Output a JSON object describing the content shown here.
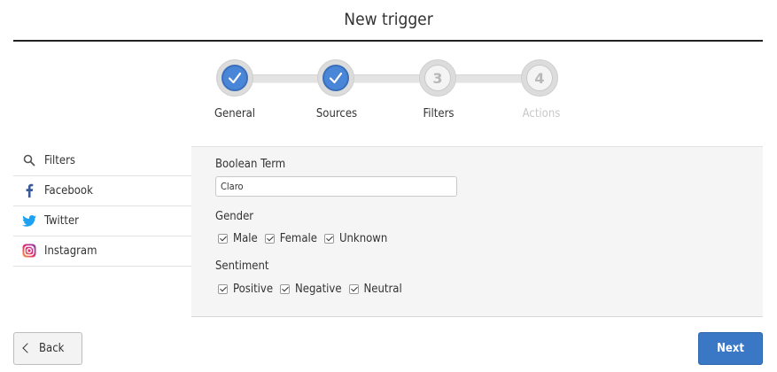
{
  "page": {
    "title": "New trigger"
  },
  "stepper": {
    "steps": [
      {
        "label": "General",
        "state": "done",
        "number": "1"
      },
      {
        "label": "Sources",
        "state": "done",
        "number": "2"
      },
      {
        "label": "Filters",
        "state": "current",
        "number": "3"
      },
      {
        "label": "Actions",
        "state": "disabled",
        "number": "4"
      }
    ]
  },
  "sidebar": {
    "items": [
      {
        "label": "Filters",
        "icon": "search-icon"
      },
      {
        "label": "Facebook",
        "icon": "facebook-icon"
      },
      {
        "label": "Twitter",
        "icon": "twitter-icon"
      },
      {
        "label": "Instagram",
        "icon": "instagram-icon"
      }
    ]
  },
  "filters": {
    "boolean_label": "Boolean Term",
    "boolean_value": "Claro",
    "gender_label": "Gender",
    "gender_options": [
      {
        "label": "Male",
        "checked": true
      },
      {
        "label": "Female",
        "checked": true
      },
      {
        "label": "Unknown",
        "checked": true
      }
    ],
    "sentiment_label": "Sentiment",
    "sentiment_options": [
      {
        "label": "Positive",
        "checked": true
      },
      {
        "label": "Negative",
        "checked": true
      },
      {
        "label": "Neutral",
        "checked": true
      }
    ]
  },
  "footer": {
    "back_label": "Back",
    "next_label": "Next"
  },
  "colors": {
    "accent": "#3a78c6",
    "step_done": "#4a86d8",
    "panel_bg": "#f5f5f5"
  }
}
